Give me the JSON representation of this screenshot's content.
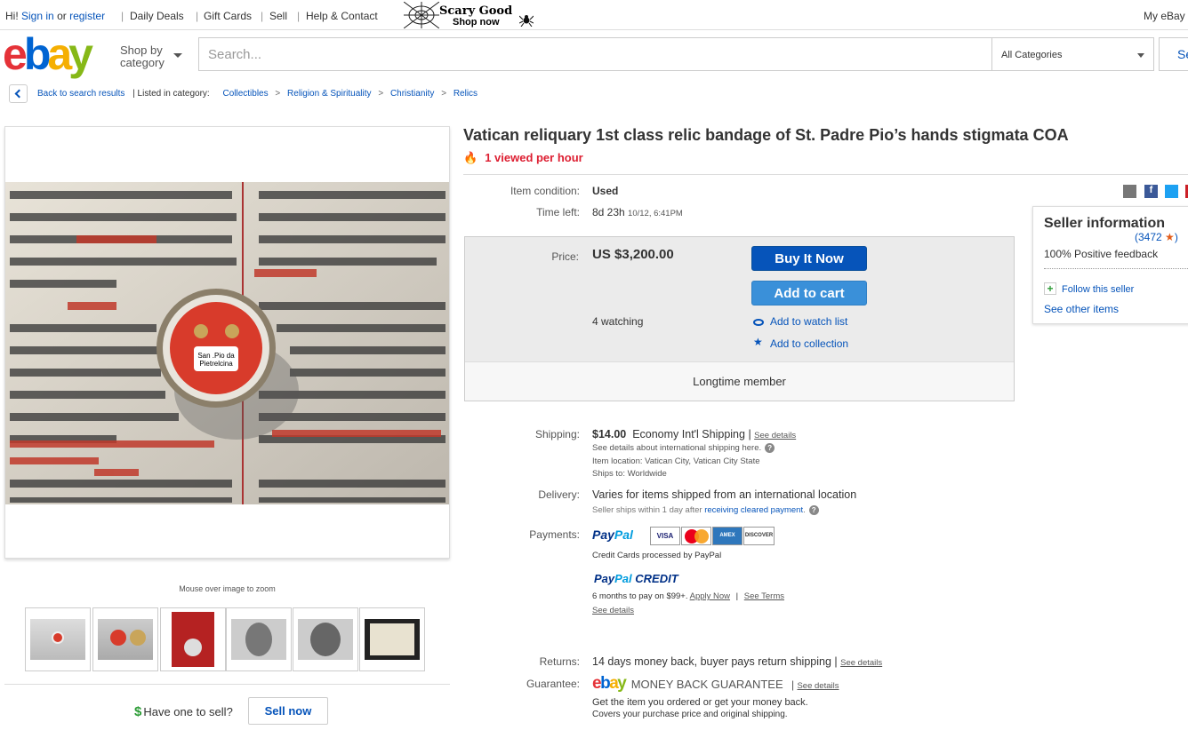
{
  "topbar": {
    "greeting_prefix": "Hi!",
    "sign_in": "Sign in",
    "or": "or",
    "register": "register",
    "daily_deals": "Daily Deals",
    "gift_cards": "Gift Cards",
    "sell": "Sell",
    "help_contact": "Help & Contact",
    "promo_line1": "Scary Good",
    "promo_line2": "Shop now",
    "my_ebay": "My eBay"
  },
  "header": {
    "logo_letters": [
      "e",
      "b",
      "a",
      "y"
    ],
    "shop_by_line1": "Shop by",
    "shop_by_line2": "category",
    "search_placeholder": "Search...",
    "category_selected": "All Categories",
    "search_button": "Se"
  },
  "breadcrumb": {
    "back": "Back to search results",
    "listed_in": "| Listed in category:",
    "items": [
      "Collectibles",
      "Religion & Spirituality",
      "Christianity",
      "Relics"
    ],
    "separator": ">"
  },
  "gallery": {
    "zoom_hint": "Mouse over image to zoom",
    "photo_label_line1": "San .Pio da",
    "photo_label_line2": "Pietrelcina"
  },
  "sell_prompt": {
    "label": "Have one to sell?",
    "dollar": "$",
    "button": "Sell now"
  },
  "listing": {
    "title": "Vatican reliquary 1st class relic bandage of St. Padre Pio’s hands stigmata COA",
    "viewed": "1 viewed per hour",
    "condition_label": "Item condition:",
    "condition_value": "Used",
    "time_left_label": "Time left:",
    "time_left_value": "8d 23h",
    "time_left_end": "10/12, 6:41PM",
    "price_label": "Price:",
    "price_value": "US $3,200.00",
    "buy_now": "Buy It Now",
    "add_to_cart": "Add to cart",
    "watching": "4 watching",
    "add_watch": "Add to watch list",
    "add_collection": "Add to collection",
    "member_badge": "Longtime member"
  },
  "seller": {
    "heading": "Seller information",
    "feedback_count": "(3472",
    "feedback_close": ")",
    "positive": "100% Positive feedback",
    "follow": "Follow this seller",
    "other_items": "See other items"
  },
  "shipping": {
    "label": "Shipping:",
    "cost": "$14.00",
    "method": "Economy Int'l Shipping",
    "bar": "|",
    "see_details": "See details",
    "intl_note": "See details about international shipping here.",
    "location": "Item location:  Vatican City, Vatican City State",
    "ships_to": "Ships to:  Worldwide"
  },
  "delivery": {
    "label": "Delivery:",
    "text": "Varies for items shipped from an international location",
    "handling_prefix": "Seller ships within 1 day after",
    "handling_link": "receiving cleared payment",
    "handling_suffix": "."
  },
  "payments": {
    "label": "Payments:",
    "paypal_a": "Pay",
    "paypal_b": "Pal",
    "cards": [
      "VISA",
      "MC",
      "AMEX",
      "DISCOVER"
    ],
    "cc_note": "Credit Cards processed by PayPal",
    "credit_a": "Pay",
    "credit_b": "Pal",
    "credit_c": "CREDIT",
    "months": "6 months to pay on $99+.",
    "apply_now": "Apply Now",
    "see_terms": "See Terms",
    "see_details": "See details"
  },
  "returns": {
    "label": "Returns:",
    "text": "14 days money back, buyer pays return shipping",
    "see_details": "See details"
  },
  "guarantee": {
    "label": "Guarantee:",
    "mbg": "MONEY BACK GUARANTEE",
    "see_details": "See details",
    "line1": "Get the item you ordered or get your money back.",
    "line2": "Covers your purchase price and original shipping."
  },
  "colors": {
    "ebay_red": "#e53238",
    "ebay_blue": "#0064d2",
    "ebay_yellow": "#f5af02",
    "ebay_green": "#86b817",
    "link": "#0654ba",
    "urgent": "#dd1e31"
  }
}
